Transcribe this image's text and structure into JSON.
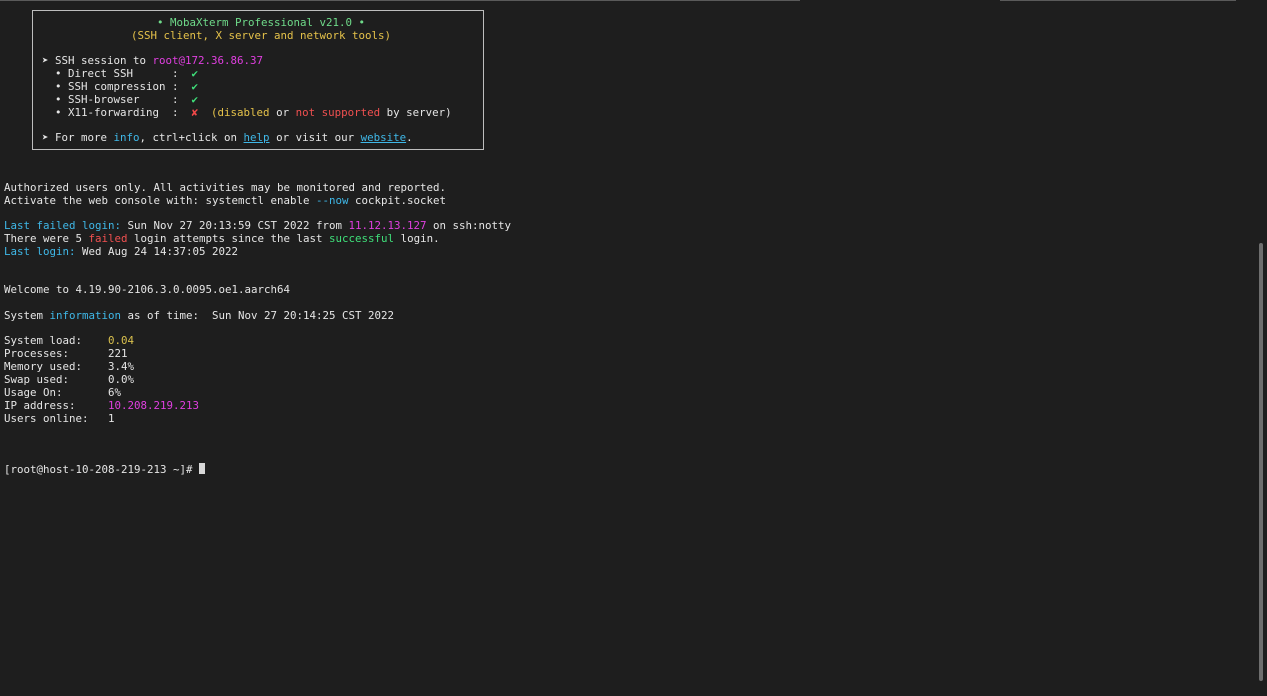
{
  "banner": {
    "title": "• MobaXterm Professional v21.0 •",
    "subtitle": "(SSH client, X server and network tools)",
    "session_prefix": "➤ SSH session to ",
    "session_target": "root@172.36.86.37",
    "rows": [
      {
        "label": "  • Direct SSH      :  ",
        "mark": "✔"
      },
      {
        "label": "  • SSH compression :  ",
        "mark": "✔"
      },
      {
        "label": "  • SSH-browser     :  ",
        "mark": "✔"
      },
      {
        "label": "  • X11-forwarding  :  ",
        "mark": "✘"
      }
    ],
    "x11_note_pre": "  (",
    "x11_disabled": "disabled",
    "x11_or": " or ",
    "x11_not_supported": "not supported",
    "x11_by_server": " by server)",
    "more_prefix": "➤ For more ",
    "more_info": "info",
    "more_mid": ", ctrl+click on ",
    "more_help": "help",
    "more_or": " or visit our ",
    "more_website": "website",
    "more_end": "."
  },
  "motd": {
    "authorized": "Authorized users only. All activities may be monitored and reported.",
    "activate_pre": "Activate the web console with: systemctl enable ",
    "activate_flag": "--now",
    "activate_post": " cockpit.socket"
  },
  "login": {
    "failed_label": "Last failed login:",
    "failed_time": " Sun Nov 27 20:13:59 CST 2022 from ",
    "failed_ip": "11.12.13.127",
    "failed_tty": " on ssh:notty",
    "attempts_pre": "There were 5 ",
    "attempts_failed": "failed",
    "attempts_mid": " login attempts since the last ",
    "attempts_successful": "successful",
    "attempts_post": " login.",
    "last_label": "Last login:",
    "last_time": " Wed Aug 24 14:37:05 2022"
  },
  "welcome": "Welcome to 4.19.90-2106.3.0.0095.oe1.aarch64",
  "sysinfo": {
    "pre": "System ",
    "word": "information",
    "post": " as of time:  Sun Nov 27 20:14:25 CST 2022",
    "rows": [
      {
        "label": "System load:    ",
        "value": "0.04"
      },
      {
        "label": "Processes:      ",
        "value": "221"
      },
      {
        "label": "Memory used:    ",
        "value": "3.4%"
      },
      {
        "label": "Swap used:      ",
        "value": "0.0%"
      },
      {
        "label": "Usage On:       ",
        "value": "6%"
      },
      {
        "label": "IP address:     ",
        "value": "10.208.219.213"
      },
      {
        "label": "Users online:   ",
        "value": "1"
      }
    ]
  },
  "prompt": "[root@host-10-208-219-213 ~]# ",
  "colors": {
    "background": "#1e1e1e",
    "banner_title": "#6fdb8a",
    "banner_subtitle": "#e5c24a",
    "magenta": "#e03fe0",
    "cyan": "#3fb8e8",
    "red": "#f05050",
    "green": "#3fe07a"
  }
}
